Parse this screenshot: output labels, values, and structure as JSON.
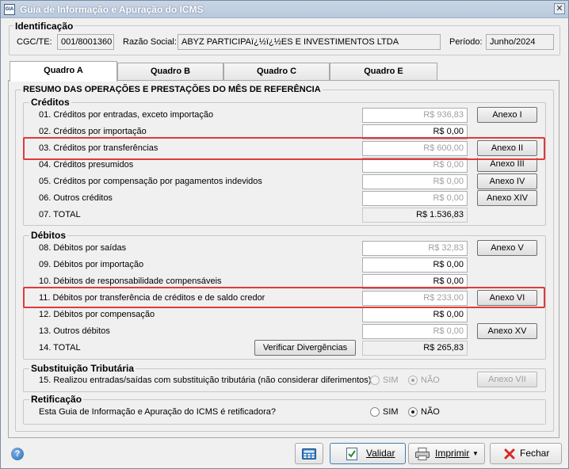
{
  "window": {
    "title": "Guia de Informação e Apuração do ICMS",
    "close": "✕",
    "app_icon": "GIA"
  },
  "identificacao": {
    "label": "Identificação",
    "cgc_label": "CGC/TE:",
    "cgc_value": "001/8001360",
    "razao_label": "Razão Social:",
    "razao_value": "ABYZ PARTICIPAï¿½ï¿½ES E INVESTIMENTOS LTDA",
    "periodo_label": "Período:",
    "periodo_value": "Junho/2024"
  },
  "tabs": [
    {
      "label": "Quadro A",
      "active": true
    },
    {
      "label": "Quadro B"
    },
    {
      "label": "Quadro C"
    },
    {
      "label": "Quadro E"
    }
  ],
  "resumo": {
    "label": "RESUMO DAS OPERAÇÕES E PRESTAÇÕES DO MÊS DE REFERÊNCIA"
  },
  "creditos": {
    "label": "Créditos",
    "rows": [
      {
        "label": "01. Créditos por entradas, exceto importação",
        "value": "R$ 936,83",
        "button": "Anexo I"
      },
      {
        "label": "02. Créditos por importação",
        "value": "R$ 0,00"
      },
      {
        "label": "03. Créditos por transferências",
        "value": "R$ 600,00",
        "button": "Anexo II"
      },
      {
        "label": "04. Créditos presumidos",
        "value": "R$ 0,00",
        "button": "Anexo III"
      },
      {
        "label": "05. Créditos por compensação por pagamentos indevidos",
        "value": "R$ 0,00",
        "button": "Anexo IV"
      },
      {
        "label": "06. Outros créditos",
        "value": "R$ 0,00",
        "button": "Anexo XIV"
      },
      {
        "label": "07. TOTAL",
        "value": "R$ 1.536,83"
      }
    ]
  },
  "debitos": {
    "label": "Débitos",
    "rows": [
      {
        "label": "08. Débitos por saídas",
        "value": "R$ 32,83",
        "button": "Anexo V"
      },
      {
        "label": "09. Débitos por importação",
        "value": "R$ 0,00"
      },
      {
        "label": "10. Débitos de responsabilidade compensáveis",
        "value": "R$ 0,00"
      },
      {
        "label": "11. Débitos por transferência de créditos e de saldo credor",
        "value": "R$ 233,00",
        "button": "Anexo VI"
      },
      {
        "label": "12. Débitos por compensação",
        "value": "R$ 0,00"
      },
      {
        "label": "13. Outros débitos",
        "value": "R$ 0,00",
        "button": "Anexo XV"
      },
      {
        "label": "14. TOTAL",
        "value": "R$ 265,83",
        "button": "Verificar Divergências"
      }
    ]
  },
  "substituicao": {
    "label": "Substituição Tributária",
    "question": "15. Realizou entradas/saídas com substituição tributária (não considerar diferimentos)",
    "sim": "SIM",
    "nao": "NÃO",
    "button": "Anexo VII"
  },
  "retificacao": {
    "label": "Retificação",
    "question": "Esta Guia de Informação e Apuração do ICMS é retificadora?",
    "sim": "SIM",
    "nao": "NÃO"
  },
  "footer": {
    "help": "?",
    "validar": "Validar",
    "imprimir": "Imprimir",
    "fechar": "Fechar"
  },
  "colors": {
    "highlight": "#e03a3a",
    "accent": "#3c7fb1"
  }
}
